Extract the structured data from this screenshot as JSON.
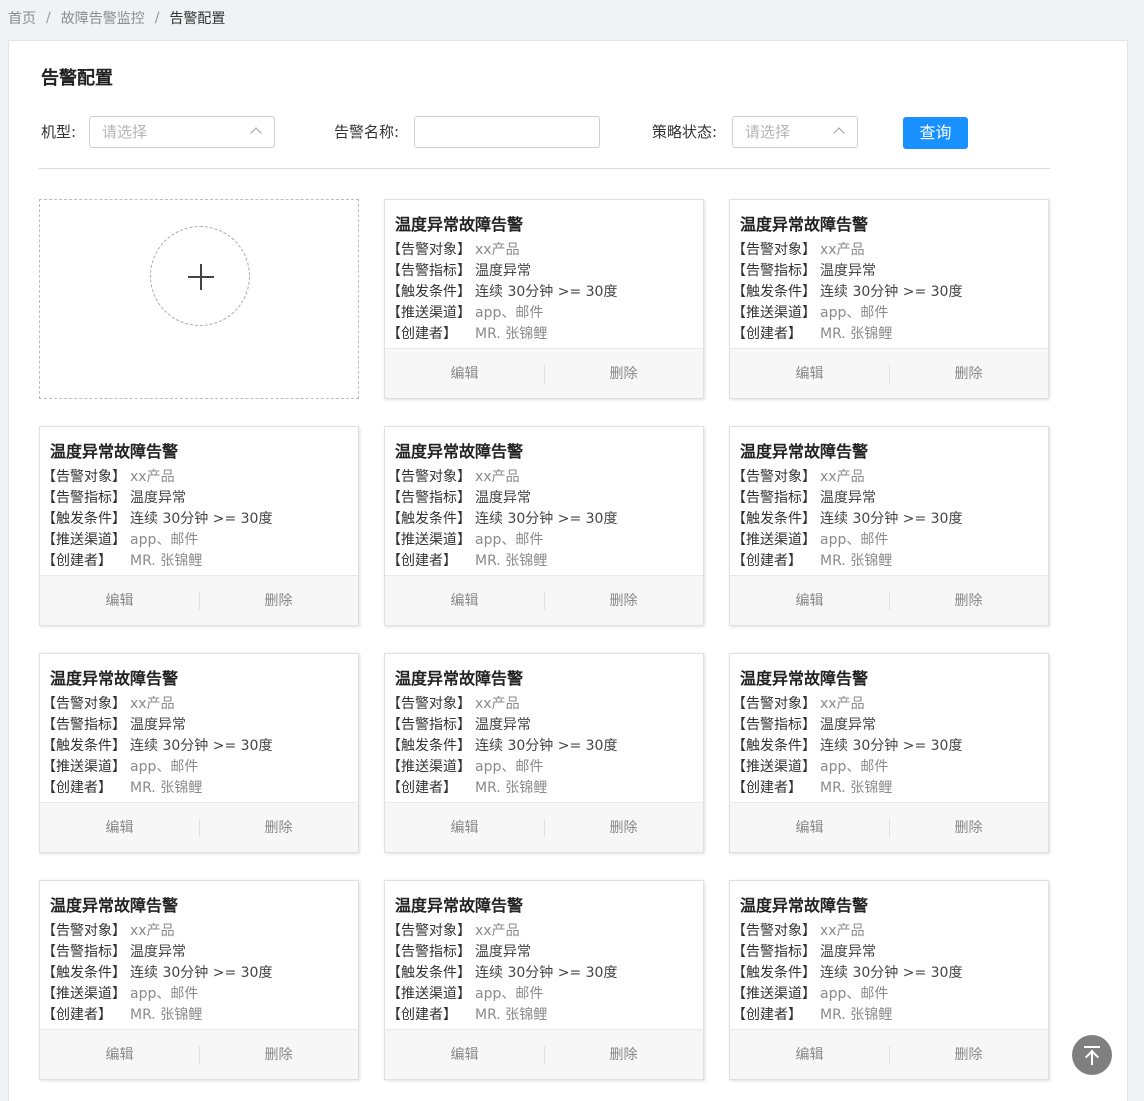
{
  "breadcrumb": {
    "items": [
      "首页",
      "故障告警监控",
      "告警配置"
    ],
    "separator": "/"
  },
  "page": {
    "title": "告警配置"
  },
  "filters": {
    "model_label": "机型:",
    "model_placeholder": "请选择",
    "alarm_name_label": "告警名称:",
    "alarm_name_value": "",
    "status_label": "策略状态:",
    "status_placeholder": "请选择",
    "query_label": "查询"
  },
  "add_card": {
    "icon": "plus-icon"
  },
  "card_common": {
    "keys": [
      "【告警对象】",
      "【告警指标】",
      "【触发条件】",
      "【推送渠道】",
      "【创建者】"
    ],
    "edit_label": "编辑",
    "delete_label": "删除"
  },
  "cards": [
    {
      "title": "温度异常故障告警",
      "values": [
        "xx产品",
        "温度异常",
        "连续 30分钟 >= 30度",
        "app、邮件",
        "MR. 张锦鲤"
      ]
    },
    {
      "title": "温度异常故障告警",
      "values": [
        "xx产品",
        "温度异常",
        "连续 30分钟 >= 30度",
        "app、邮件",
        "MR. 张锦鲤"
      ]
    },
    {
      "title": "温度异常故障告警",
      "values": [
        "xx产品",
        "温度异常",
        "连续 30分钟 >= 30度",
        "app、邮件",
        "MR. 张锦鲤"
      ]
    },
    {
      "title": "温度异常故障告警",
      "values": [
        "xx产品",
        "温度异常",
        "连续 30分钟 >= 30度",
        "app、邮件",
        "MR. 张锦鲤"
      ]
    },
    {
      "title": "温度异常故障告警",
      "values": [
        "xx产品",
        "温度异常",
        "连续 30分钟 >= 30度",
        "app、邮件",
        "MR. 张锦鲤"
      ]
    },
    {
      "title": "温度异常故障告警",
      "values": [
        "xx产品",
        "温度异常",
        "连续 30分钟 >= 30度",
        "app、邮件",
        "MR. 张锦鲤"
      ]
    },
    {
      "title": "温度异常故障告警",
      "values": [
        "xx产品",
        "温度异常",
        "连续 30分钟 >= 30度",
        "app、邮件",
        "MR. 张锦鲤"
      ]
    },
    {
      "title": "温度异常故障告警",
      "values": [
        "xx产品",
        "温度异常",
        "连续 30分钟 >= 30度",
        "app、邮件",
        "MR. 张锦鲤"
      ]
    },
    {
      "title": "温度异常故障告警",
      "values": [
        "xx产品",
        "温度异常",
        "连续 30分钟 >= 30度",
        "app、邮件",
        "MR. 张锦鲤"
      ]
    },
    {
      "title": "温度异常故障告警",
      "values": [
        "xx产品",
        "温度异常",
        "连续 30分钟 >= 30度",
        "app、邮件",
        "MR. 张锦鲤"
      ]
    },
    {
      "title": "温度异常故障告警",
      "values": [
        "xx产品",
        "温度异常",
        "连续 30分钟 >= 30度",
        "app、邮件",
        "MR. 张锦鲤"
      ]
    }
  ],
  "back_to_top": {
    "icon": "arrow-up-icon"
  },
  "colors": {
    "primary": "#1890ff",
    "page_bg": "#f0f2f5",
    "back_top_bg": "#7f7f7f"
  }
}
